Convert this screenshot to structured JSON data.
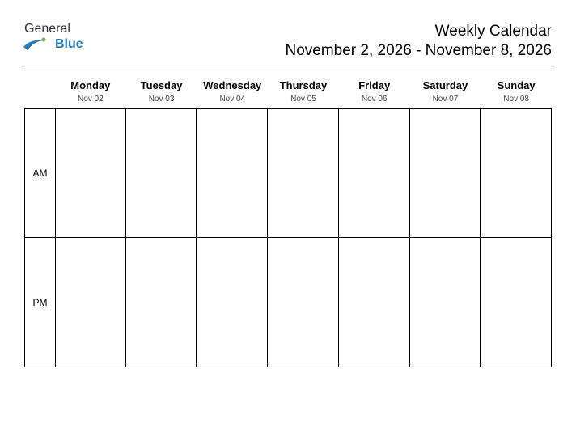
{
  "logo": {
    "line1": "General",
    "line2": "Blue"
  },
  "header": {
    "title": "Weekly Calendar",
    "date_range": "November 2, 2026 - November 8, 2026"
  },
  "periods": {
    "am": "AM",
    "pm": "PM"
  },
  "days": [
    {
      "name": "Monday",
      "date": "Nov 02"
    },
    {
      "name": "Tuesday",
      "date": "Nov 03"
    },
    {
      "name": "Wednesday",
      "date": "Nov 04"
    },
    {
      "name": "Thursday",
      "date": "Nov 05"
    },
    {
      "name": "Friday",
      "date": "Nov 06"
    },
    {
      "name": "Saturday",
      "date": "Nov 07"
    },
    {
      "name": "Sunday",
      "date": "Nov 08"
    }
  ]
}
